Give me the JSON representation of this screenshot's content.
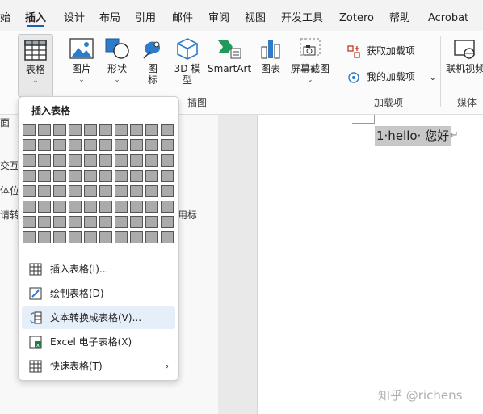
{
  "menu": {
    "tabs": [
      {
        "label": "始"
      },
      {
        "label": "插入"
      },
      {
        "label": "设计"
      },
      {
        "label": "布局"
      },
      {
        "label": "引用"
      },
      {
        "label": "邮件"
      },
      {
        "label": "审阅"
      },
      {
        "label": "视图"
      },
      {
        "label": "开发工具"
      },
      {
        "label": "Zotero"
      },
      {
        "label": "帮助"
      },
      {
        "label": "Acrobat"
      }
    ]
  },
  "ribbon": {
    "table_btn": "表格",
    "illustrations": {
      "picture": "图片",
      "shapes": "形状",
      "icons_line1": "图",
      "icons_line2": "标",
      "models_line1": "3D 模",
      "models_line2": "型",
      "smartart": "SmartArt",
      "chart": "图表",
      "screenshot": "屏幕截图",
      "group_label": "插图"
    },
    "addins": {
      "get": "获取加载项",
      "my": "我的加载项",
      "group_label": "加载项"
    },
    "media": {
      "online_video": "联机视频",
      "group_label": "媒体"
    }
  },
  "dropdown": {
    "title": "插入表格",
    "items": [
      {
        "label": "插入表格(I)..."
      },
      {
        "label": "绘制表格(D)"
      },
      {
        "label": "文本转换成表格(V)..."
      },
      {
        "label": "Excel 电子表格(X)"
      },
      {
        "label": "快速表格(T)"
      }
    ]
  },
  "left_panel": {
    "lines": [
      "面",
      "交互式",
      "体位置",
      "请转至",
      "用标"
    ]
  },
  "doc": {
    "text": "1·hello· 您好",
    "para_mark": "↵"
  },
  "watermark": "知乎 @richens",
  "colors": {
    "accent": "#1b5fb5",
    "highlight": "#e6eef9",
    "selection": "#c8c8c8"
  }
}
